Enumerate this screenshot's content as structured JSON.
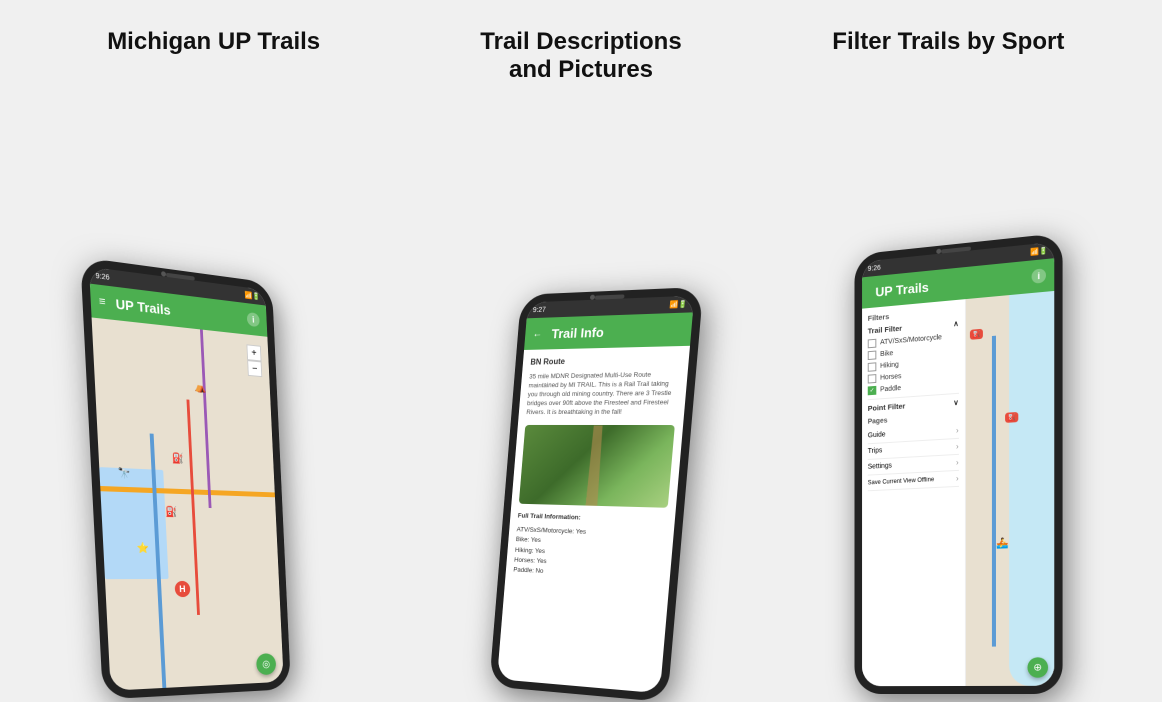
{
  "page": {
    "background": "#f0f0f0"
  },
  "headings": {
    "left": "Michigan UP Trails",
    "center": "Trail Descriptions\nand Pictures",
    "right": "Filter Trails by Sport"
  },
  "phone_left": {
    "status_time": "9:26",
    "app_title": "UP Trails",
    "map_icons": [
      "⛺",
      "🔭",
      "⛽",
      "⛽",
      "⭐",
      "H"
    ]
  },
  "phone_center": {
    "status_time": "9:27",
    "app_title": "Trail Info",
    "route_label": "BN Route",
    "description": "35 mile MDNR Designated Multi-Use Route maintained by MI TRAIL. This is a Rail Trail taking you through old mining country. There are 3 Trestle bridges over 90ft above the Firesteel and Firesteel Rivers. It is breathtaking in the fall!",
    "full_info_title": "Full Trail Information:",
    "full_info": "ATV/SxS/Motorcycle: Yes\nBike: Yes\nHiking: Yes\nHorses: Yes\nPaddle: No"
  },
  "phone_right": {
    "status_time": "9:26",
    "app_title": "UP Trails",
    "filters_label": "Filters",
    "trail_filter_label": "Trail Filter",
    "filter_items": [
      {
        "label": "ATV/SxS/Motorcycle",
        "checked": false
      },
      {
        "label": "Bike",
        "checked": false
      },
      {
        "label": "Hiking",
        "checked": false
      },
      {
        "label": "Horses",
        "checked": false
      },
      {
        "label": "Paddle",
        "checked": true
      }
    ],
    "point_filter_label": "Point Filter",
    "pages_label": "Pages",
    "page_items": [
      "Guide",
      "Trips",
      "Settings",
      "Save Current View Offline"
    ]
  }
}
